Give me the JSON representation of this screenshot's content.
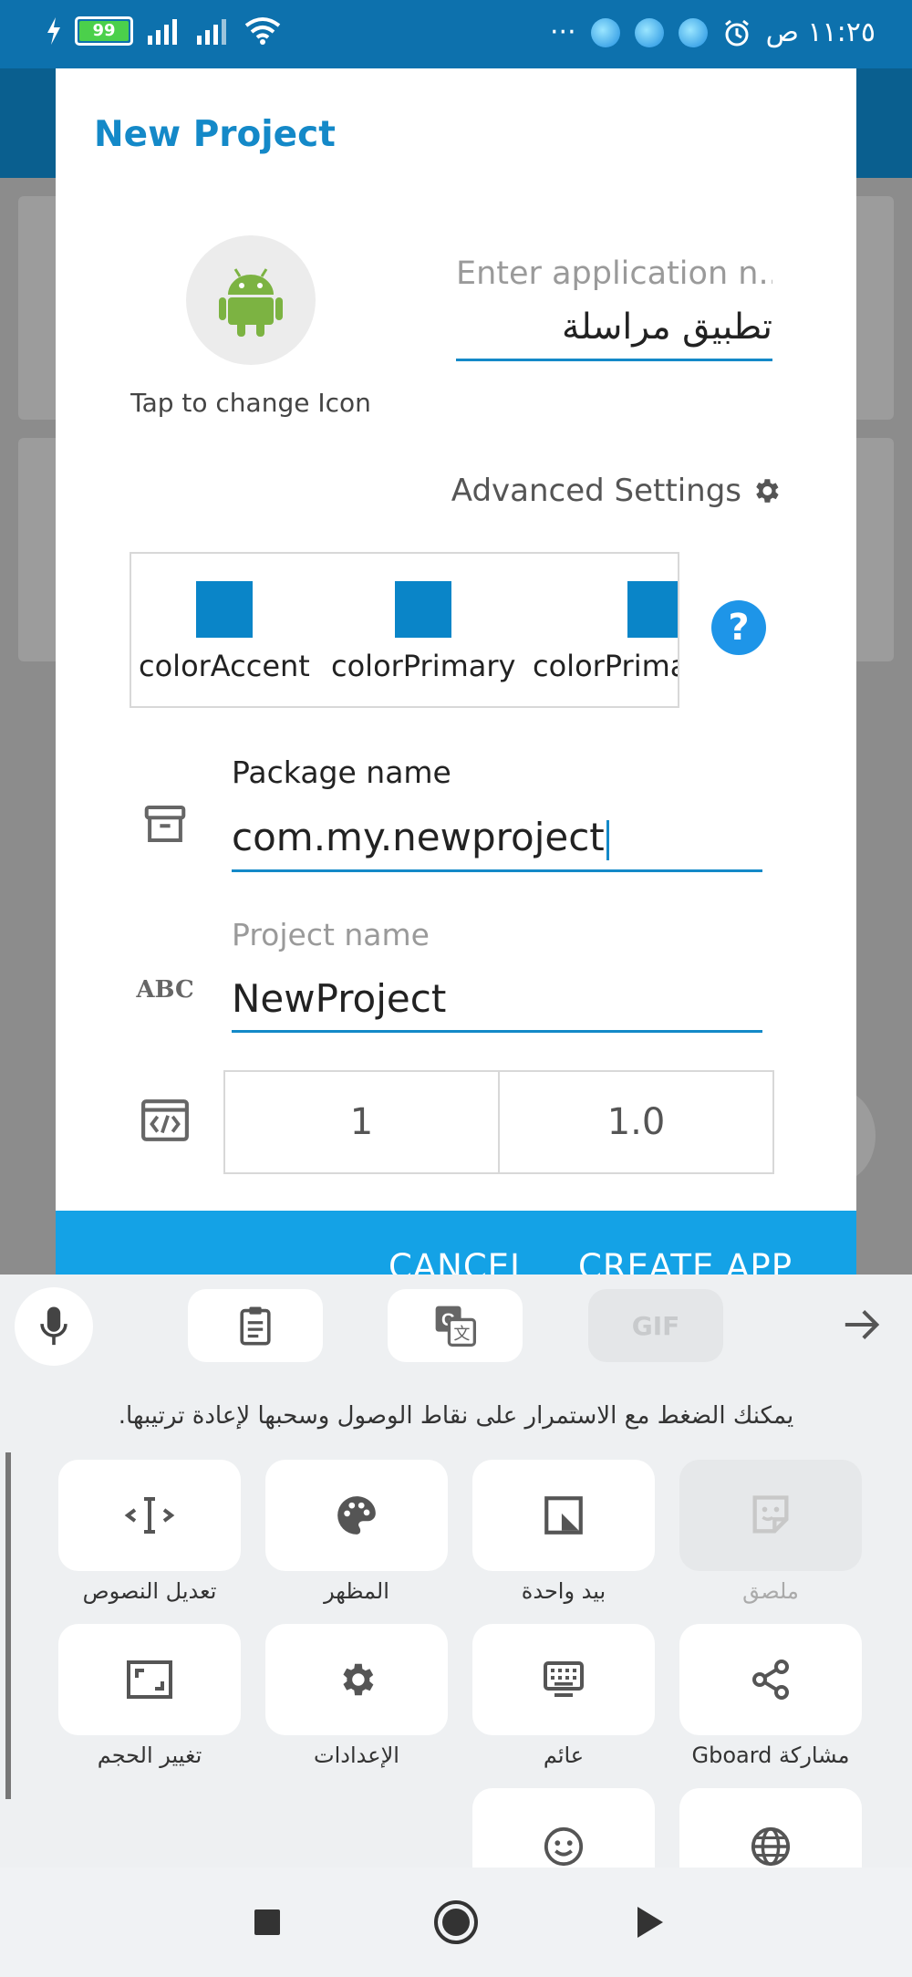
{
  "status_bar": {
    "battery": "99",
    "time": "١١:٢٥ ص",
    "overflow_dots": "···"
  },
  "dialog": {
    "title": "New Project",
    "icon_caption": "Tap to change Icon",
    "app_name_placeholder": "Enter application n...",
    "app_name_value": "تطبيق مراسلة",
    "advanced_settings": "Advanced Settings",
    "colors": [
      "colorAccent",
      "colorPrimary",
      "colorPrima"
    ],
    "help": "?",
    "package_label": "Package name",
    "package_value": "com.my.newproject",
    "project_label": "Project name",
    "project_value": "NewProject",
    "version_code": "1",
    "version_name": "1.0",
    "cancel": "CANCEL",
    "create": "CREATE APP",
    "colors_hex": {
      "accent": "#1489c8",
      "swatch": "#0a85c8",
      "button_bar": "#14a2e6"
    }
  },
  "keyboard": {
    "gif_label": "GIF",
    "hint": "يمكنك الضغط مع الاستمرار على نقاط الوصول وسحبها لإعادة ترتيبها.",
    "tiles": [
      {
        "label": "ملصق",
        "icon": "sticker-icon"
      },
      {
        "label": "بيد واحدة",
        "icon": "one-hand-icon"
      },
      {
        "label": "المظهر",
        "icon": "palette-icon"
      },
      {
        "label": "تعديل النصوص",
        "icon": "text-edit-icon"
      },
      {
        "label": "مشاركة Gboard",
        "icon": "share-icon"
      },
      {
        "label": "عائم",
        "icon": "floating-keyboard-icon"
      },
      {
        "label": "الإعدادات",
        "icon": "gear-icon"
      },
      {
        "label": "تغيير الحجم",
        "icon": "resize-icon"
      }
    ]
  }
}
